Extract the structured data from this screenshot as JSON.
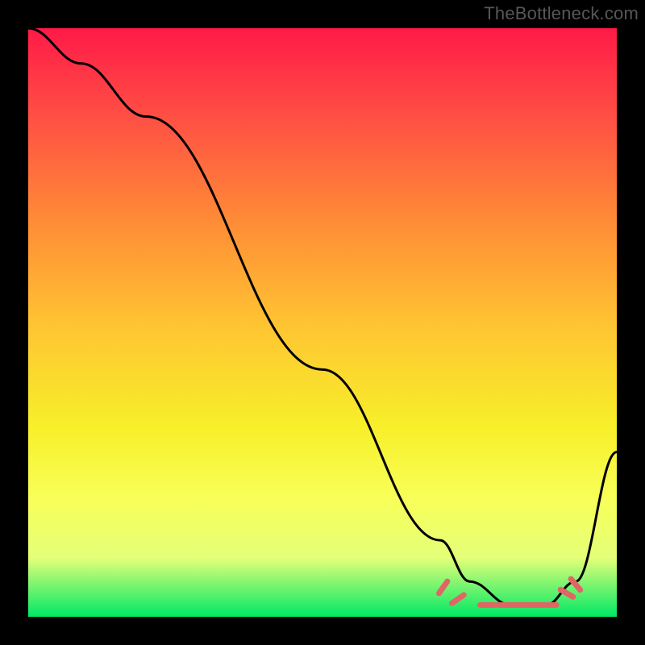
{
  "watermark": "TheBottleneck.com",
  "chart_data": {
    "type": "line",
    "title": "",
    "xlabel": "",
    "ylabel": "",
    "xlim": [
      0,
      100
    ],
    "ylim": [
      0,
      100
    ],
    "series": [
      {
        "name": "curve",
        "color": "#000000",
        "x": [
          0,
          9,
          20,
          50,
          70,
          75,
          82,
          88,
          93,
          100
        ],
        "y": [
          100,
          94,
          85,
          42,
          13,
          6,
          2,
          2,
          6,
          28
        ]
      },
      {
        "name": "optimal-dashes",
        "type": "scatter",
        "color": "#e06666",
        "points": [
          {
            "x": 70.5,
            "y": 5.0
          },
          {
            "x": 73.0,
            "y": 3.0
          },
          {
            "x": 78.0,
            "y": 2.0
          },
          {
            "x": 81.0,
            "y": 2.0
          },
          {
            "x": 83.5,
            "y": 2.0
          },
          {
            "x": 86.0,
            "y": 2.0
          },
          {
            "x": 88.5,
            "y": 2.0
          },
          {
            "x": 91.5,
            "y": 4.0
          },
          {
            "x": 93.0,
            "y": 5.5
          }
        ]
      }
    ],
    "gradient_colors": {
      "top": "#ff1a48",
      "mid": "#f7f02a",
      "bottom": "#00e865"
    }
  }
}
